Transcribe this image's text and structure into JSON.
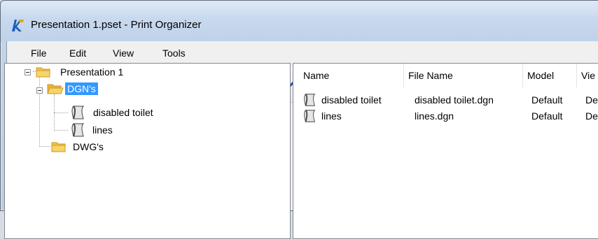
{
  "window": {
    "title": "Presentation 1.pset - Print Organizer",
    "app_icon": "print-organizer-app-icon"
  },
  "menu": [
    "File",
    "Edit",
    "View",
    "Tools"
  ],
  "toolbar": {
    "buttons": [
      {
        "name": "new-icon"
      },
      {
        "name": "open-folder-icon"
      },
      {
        "name": "save-icon"
      },
      {
        "name": "print-icon"
      },
      {
        "name": "print-preview-icon"
      },
      {
        "name": "new-folder-icon"
      },
      {
        "name": "add-files-icon"
      },
      {
        "name": "delete-icon"
      },
      {
        "name": "properties-icon"
      },
      {
        "name": "move-to-top-icon"
      },
      {
        "name": "move-up-icon"
      },
      {
        "name": "move-down-icon"
      },
      {
        "name": "move-to-bottom-icon"
      },
      {
        "name": "view-options-icon"
      },
      {
        "name": "go-up-folder-icon"
      }
    ]
  },
  "tree": {
    "root": "Presentation 1",
    "folder_dgn": "DGN's",
    "dgn_items": [
      "disabled toilet",
      "lines"
    ],
    "folder_dwg": "DWG's"
  },
  "list": {
    "columns": [
      "Name",
      "File Name",
      "Model",
      "Vie"
    ],
    "rows": [
      {
        "name": "disabled toilet",
        "file": "disabled toilet.dgn",
        "model": "Default",
        "view": "De"
      },
      {
        "name": "lines",
        "file": "lines.dgn",
        "model": "Default",
        "view": "De"
      }
    ]
  }
}
